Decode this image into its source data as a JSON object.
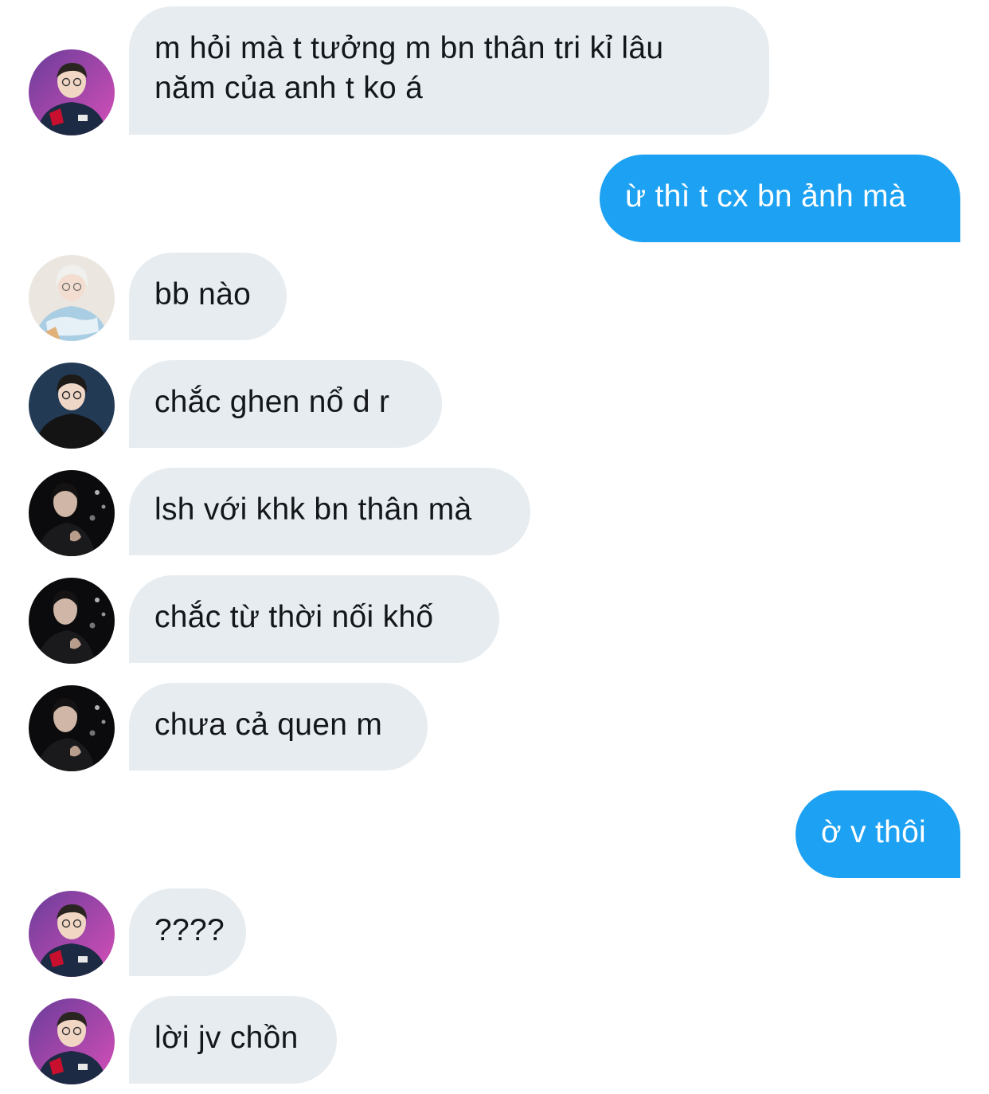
{
  "messages": [
    {
      "direction": "incoming",
      "avatar": "avatar-a",
      "text": "m hỏi mà t tưởng m bn thân tri kỉ lâu\nnăm của anh t ko á"
    },
    {
      "direction": "outgoing",
      "text": "ừ thì t cx bn ảnh mà"
    },
    {
      "direction": "incoming",
      "avatar": "avatar-b",
      "text": "bb nào"
    },
    {
      "direction": "incoming",
      "avatar": "avatar-c",
      "text": "chắc ghen nổ d r"
    },
    {
      "direction": "incoming",
      "avatar": "avatar-d",
      "text": "lsh với khk bn thân mà"
    },
    {
      "direction": "incoming",
      "avatar": "avatar-d",
      "text": "chắc từ thời nối khố"
    },
    {
      "direction": "incoming",
      "avatar": "avatar-d",
      "text": "chưa cả quen m"
    },
    {
      "direction": "outgoing",
      "text": "ờ v thôi"
    },
    {
      "direction": "incoming",
      "avatar": "avatar-a",
      "text": "????"
    },
    {
      "direction": "incoming",
      "avatar": "avatar-a",
      "text": "lời jv chồn"
    }
  ],
  "colors": {
    "incoming_bubble": "#e6ecf0",
    "incoming_text": "#14171a",
    "outgoing_bubble": "#1da1f2",
    "outgoing_text": "#ffffff"
  }
}
